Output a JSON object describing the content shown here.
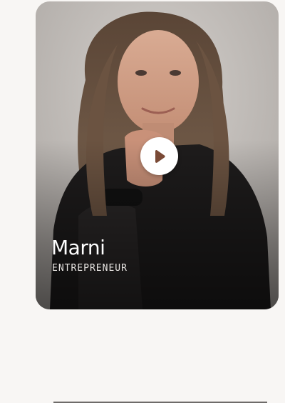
{
  "profile_card": {
    "name": "Marni",
    "role": "ENTREPRENEUR"
  },
  "icons": {
    "play": "play-icon"
  },
  "colors": {
    "page_background": "#f8f6f4",
    "name_text": "#ffffff",
    "play_button_bg": "#ffffff",
    "play_icon": "#7a4a36"
  }
}
